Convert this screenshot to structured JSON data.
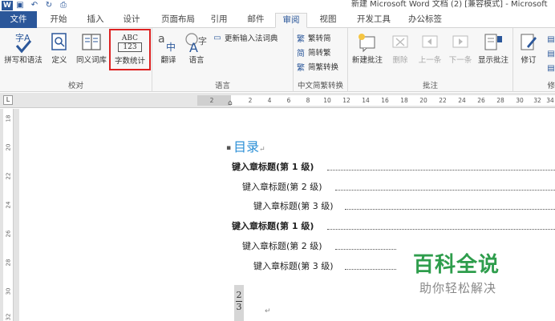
{
  "window": {
    "title": "新建 Microsoft Word 文档 (2) [兼容模式] - Microsoft"
  },
  "tabs": [
    "文件",
    "开始",
    "插入",
    "设计",
    "页面布局",
    "引用",
    "邮件",
    "审阅",
    "视图",
    "开发工具",
    "办公标签"
  ],
  "active_tab": "审阅",
  "ribbon": {
    "proofing": {
      "group_label": "校对",
      "spelling": "拼写和语法",
      "define": "定义",
      "thesaurus": "同义词库",
      "word_count": "字数统计"
    },
    "language": {
      "group_label": "语言",
      "translate": "翻译",
      "language": "语言",
      "update_ime": "更新输入法词典"
    },
    "chinese": {
      "group_label": "中文简繁转换",
      "to_simplified": "繁转简",
      "to_traditional": "简转繁",
      "convert": "简繁转换"
    },
    "comments": {
      "group_label": "批注",
      "new": "新建批注",
      "delete": "删除",
      "previous": "上一条",
      "next": "下一条",
      "show": "显示批注"
    },
    "tracking": {
      "track": "修订",
      "partial_label": "修"
    },
    "icons": {
      "spelling_icon_text": "字A",
      "abc_top": "ABC",
      "abc_bottom": "123"
    }
  },
  "ruler": {
    "corner": "L",
    "ticks": [
      "2",
      "2",
      "4",
      "6",
      "8",
      "10",
      "12",
      "14",
      "16",
      "18",
      "20",
      "22",
      "24",
      "26",
      "28",
      "30",
      "32",
      "34"
    ],
    "vticks": [
      "18",
      "20",
      "22",
      "24",
      "26",
      "28",
      "30",
      "32"
    ]
  },
  "document": {
    "toc_title": "目录",
    "para_mark": "↵",
    "entries": [
      {
        "level": 1,
        "text": "键入章标题(第 1 级)"
      },
      {
        "level": 2,
        "text": "键入章标题(第 2 级)"
      },
      {
        "level": 3,
        "text": "键入章标题(第 3 级)"
      },
      {
        "level": 1,
        "text": "键入章标题(第 1 级)"
      },
      {
        "level": 2,
        "text": "键入章标题(第 2 级)"
      },
      {
        "level": 3,
        "text": "键入章标题(第 3 级)"
      }
    ],
    "page_num_top": "2",
    "page_num_bottom": "3"
  },
  "watermark": {
    "title": "百科全说",
    "subtitle": "助你轻松解决"
  }
}
